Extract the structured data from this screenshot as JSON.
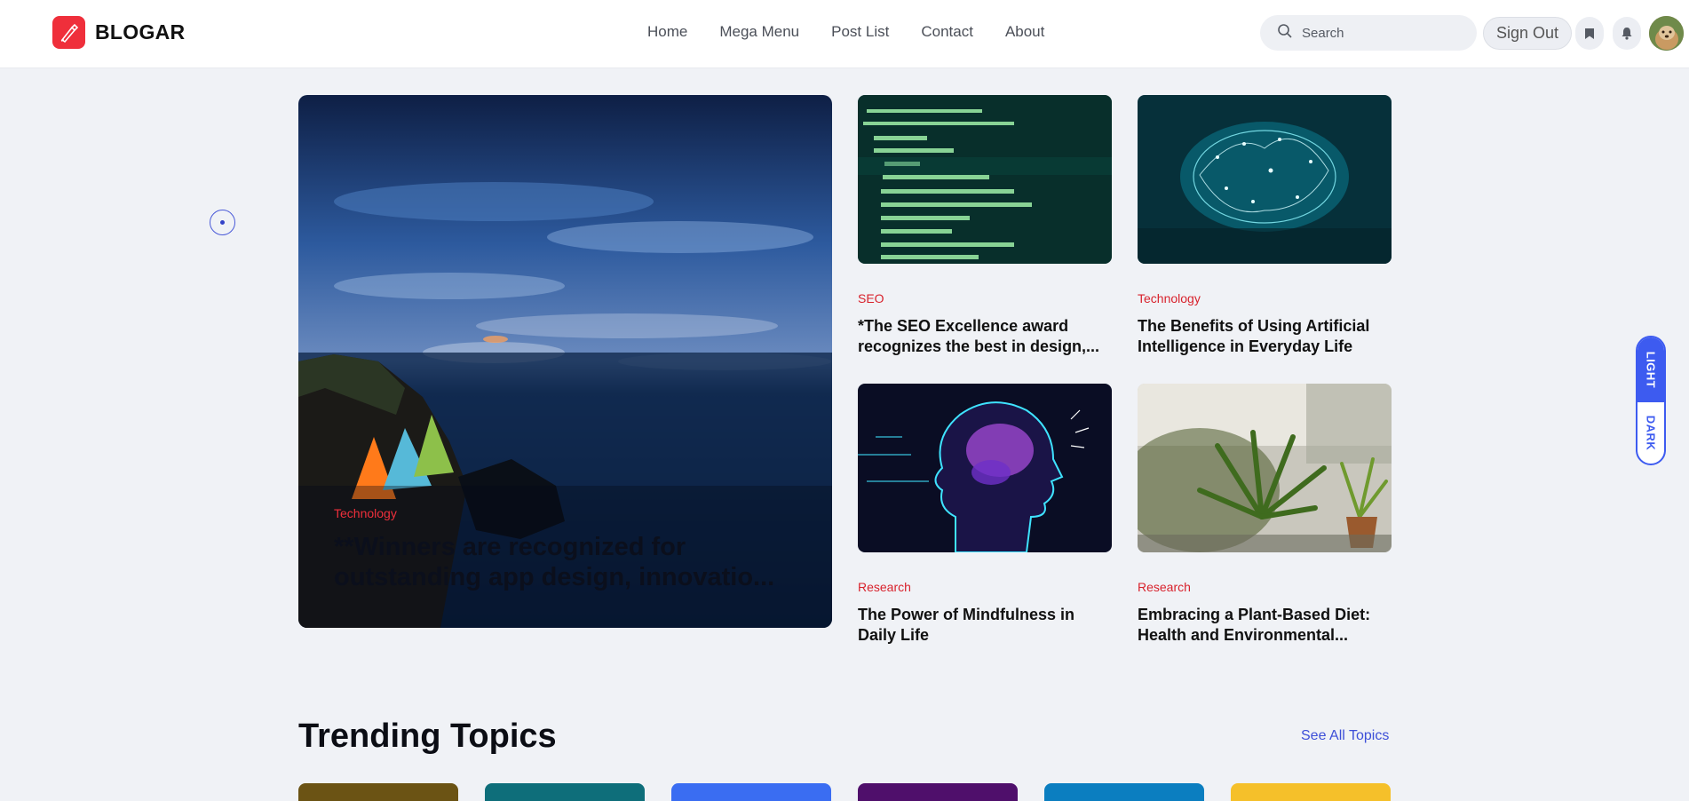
{
  "header": {
    "logo_text": "BLOGAR",
    "nav": [
      "Home",
      "Mega Menu",
      "Post List",
      "Contact",
      "About"
    ],
    "search_placeholder": "Search",
    "signout_label": "Sign Out"
  },
  "theme_toggle": {
    "light": "LIGHT",
    "dark": "DARK"
  },
  "hero": {
    "category": "Technology",
    "title": "**Winners are recognized for outstanding app design, innovatio..."
  },
  "cards": [
    {
      "category": "SEO",
      "title": "*The SEO Excellence award recognizes the best in design,..."
    },
    {
      "category": "Technology",
      "title": "The Benefits of Using Artificial Intelligence in Everyday Life"
    },
    {
      "category": "Research",
      "title": "The Power of Mindfulness in Daily Life"
    },
    {
      "category": "Research",
      "title": "Embracing a Plant-Based Diet: Health and Environmental..."
    }
  ],
  "trending": {
    "title": "Trending Topics",
    "see_all": "See All Topics"
  },
  "colors": {
    "accent": "#3d5bf0",
    "brand": "#ef2f3b",
    "topics": [
      "#6b5314",
      "#0e6e7a",
      "#3a6df2",
      "#4f0f6b",
      "#0b7ec0",
      "#f5c02a"
    ]
  },
  "icons": [
    "pen-logo-icon",
    "search-icon",
    "bookmark-icon",
    "bell-icon"
  ]
}
